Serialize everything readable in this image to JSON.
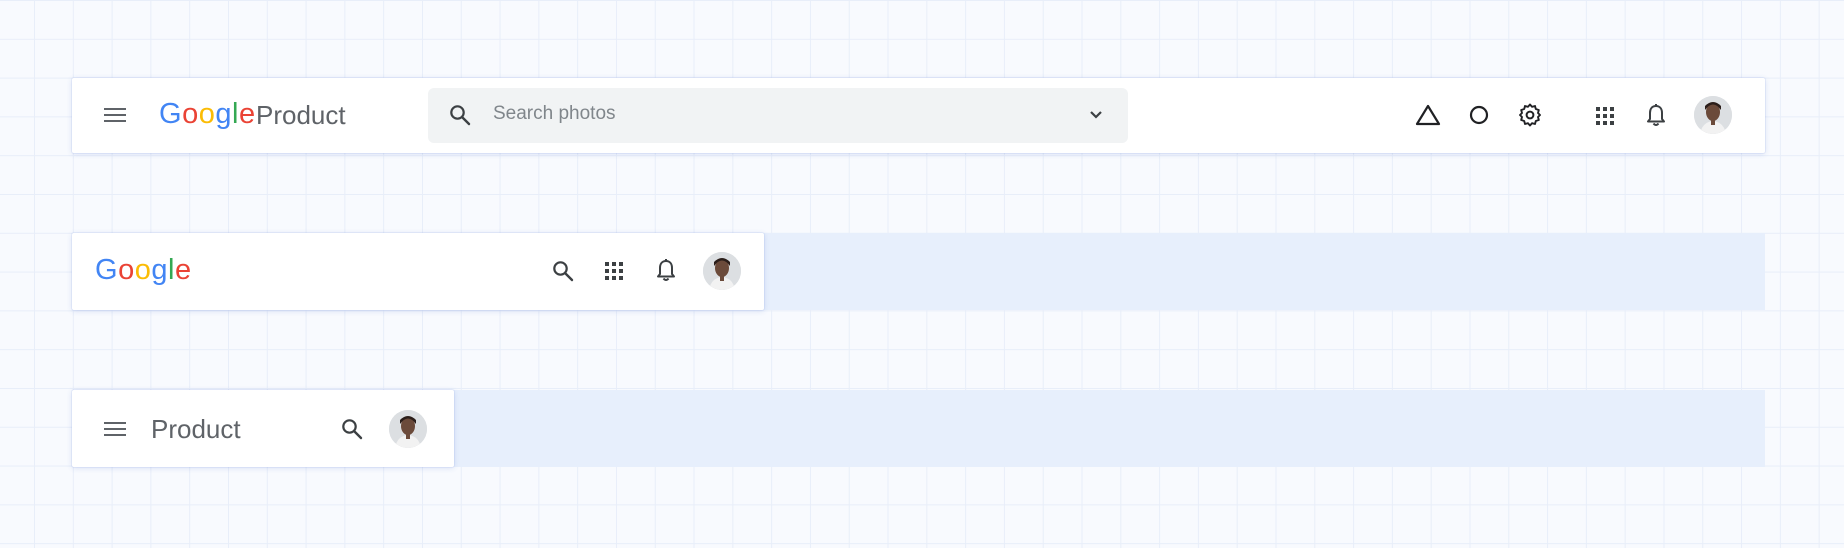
{
  "colors": {
    "brand_blue": "#4285F4",
    "brand_red": "#EA4335",
    "brand_yellow": "#FBBC05",
    "brand_green": "#34A853",
    "icon_gray": "#5f6368",
    "row_highlight": "#e7effc"
  },
  "brand": {
    "letters": [
      "G",
      "o",
      "o",
      "g",
      "l",
      "e"
    ]
  },
  "bar_full": {
    "menu_icon": "menu-icon",
    "product_name": "Product",
    "search_placeholder": "Search photos",
    "search_icon": "search-icon",
    "dropdown_icon": "chevron-down-icon",
    "action_icons": [
      "triangle-icon",
      "circle-icon",
      "settings-gear-icon"
    ],
    "app_icons": [
      "apps-grid-icon",
      "notifications-bell-icon"
    ],
    "avatar": "profile-avatar"
  },
  "bar_logo": {
    "icons": [
      "search-icon",
      "apps-grid-icon",
      "notifications-bell-icon"
    ],
    "avatar": "profile-avatar"
  },
  "bar_compact": {
    "menu_icon": "menu-icon",
    "product_name": "Product",
    "icons": [
      "search-icon"
    ],
    "avatar": "profile-avatar"
  }
}
